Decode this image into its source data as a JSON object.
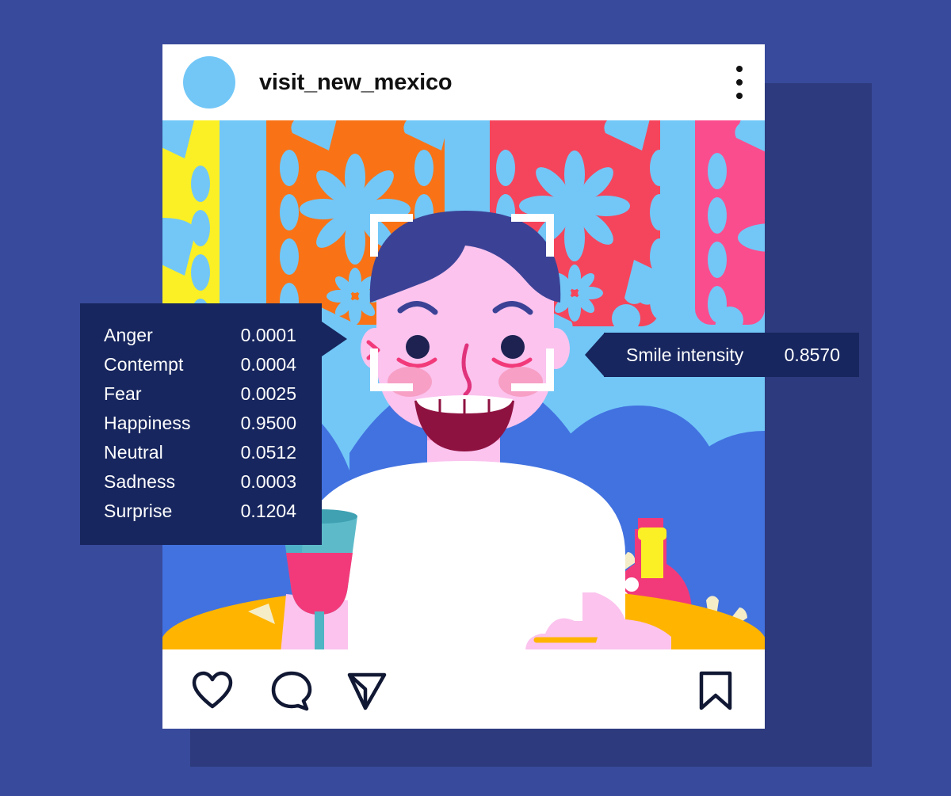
{
  "background_color": "#384a9b",
  "post": {
    "username": "visit_new_mexico",
    "avatar_icon": "avatar-circle",
    "more_options_icon": "kebab-menu-icon",
    "actions": [
      {
        "name": "like",
        "icon": "heart-icon"
      },
      {
        "name": "comment",
        "icon": "comment-bubble-icon"
      },
      {
        "name": "share",
        "icon": "send-paper-plane-icon"
      },
      {
        "name": "save",
        "icon": "bookmark-icon"
      }
    ]
  },
  "face_detection": {
    "bracket_icon": "face-detection-brackets",
    "bracket_color": "#ffffff"
  },
  "emotions_panel": {
    "panel_color": "#17265e",
    "text_color": "#ffffff",
    "rows": [
      {
        "label": "Anger",
        "value": "0.0001"
      },
      {
        "label": "Contempt",
        "value": "0.0004"
      },
      {
        "label": "Fear",
        "value": "0.0025"
      },
      {
        "label": "Happiness",
        "value": "0.9500"
      },
      {
        "label": "Neutral",
        "value": "0.0512"
      },
      {
        "label": "Sadness",
        "value": "0.0003"
      },
      {
        "label": "Surprise",
        "value": "0.1204"
      }
    ]
  },
  "smile_panel": {
    "panel_color": "#17265e",
    "label": "Smile intensity",
    "value": "0.8570"
  },
  "illustration": {
    "palette": {
      "sky": "#72c7f7",
      "hill": "#4272e0",
      "banner_yellow": "#fbf025",
      "banner_orange": "#f97316",
      "banner_red": "#f5455c",
      "banner_pink": "#fa4d8e",
      "table_yellow": "#ffb400",
      "table_orange": "#fa7a18",
      "skin": "#fbc3ee",
      "hair": "#3b4296",
      "shirt": "#ffffff",
      "wine": "#f23a7a",
      "glass": "#4fb5c4",
      "bottle_label": "#fbf025",
      "flower": "#f5edc8",
      "mouth": "#8e1240"
    }
  }
}
